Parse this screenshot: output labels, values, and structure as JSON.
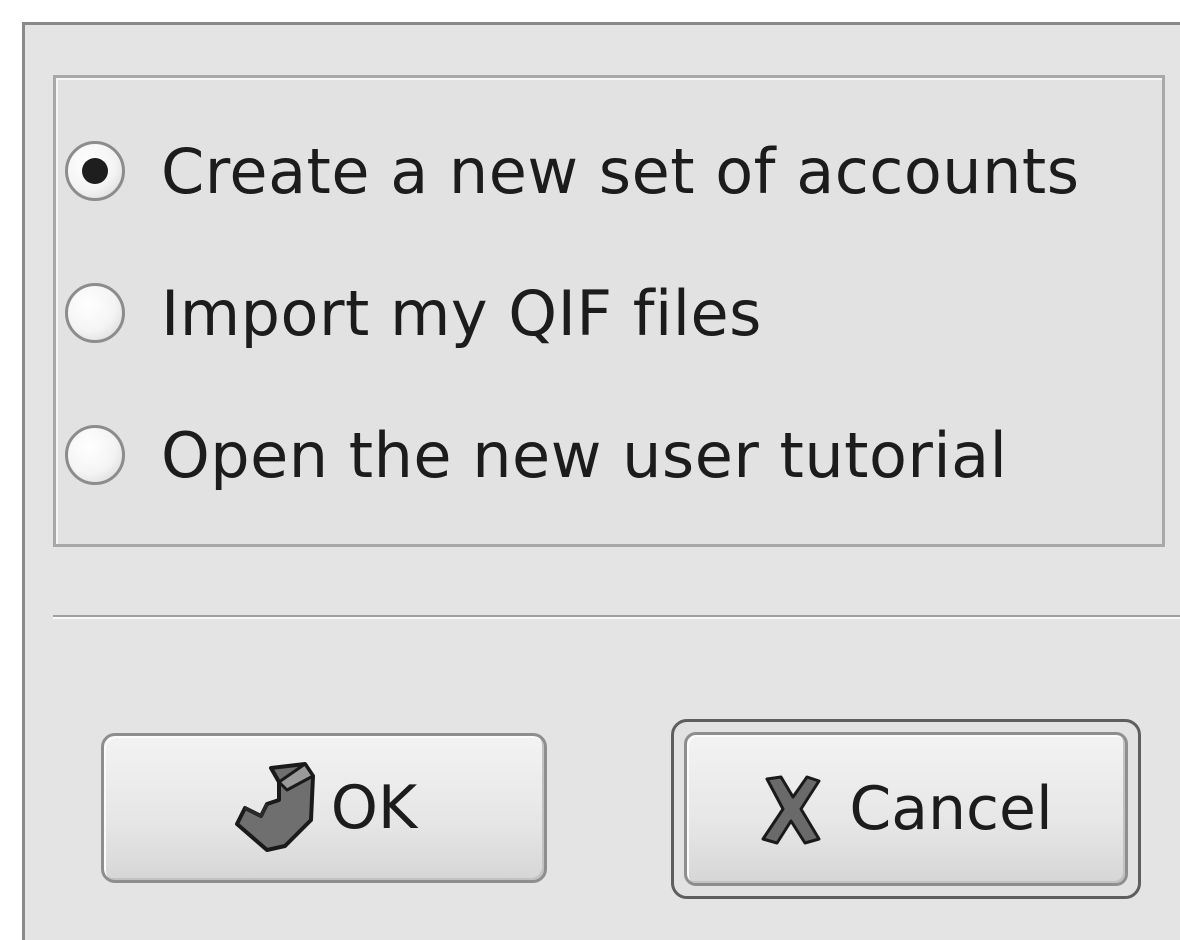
{
  "dialog": {
    "options": [
      {
        "label": "Create a new set of accounts",
        "selected": true
      },
      {
        "label": "Import my QIF files",
        "selected": false
      },
      {
        "label": "Open the new user tutorial",
        "selected": false
      }
    ],
    "buttons": {
      "ok": {
        "label": "OK",
        "icon": "apply-check-icon"
      },
      "cancel": {
        "label": "Cancel",
        "icon": "cancel-x-icon"
      }
    }
  }
}
